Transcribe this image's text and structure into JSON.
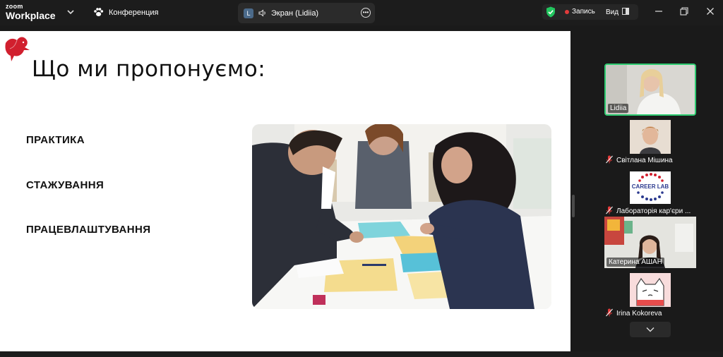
{
  "app": {
    "brand_small": "zoom",
    "brand_large": "Workplace"
  },
  "meeting": {
    "title": "Конференция"
  },
  "share": {
    "badge": "L",
    "label": "Экран (Lidiia)"
  },
  "toolbar": {
    "record_label": "Запись",
    "view_label": "Вид"
  },
  "slide": {
    "title": "Що ми пропонуємо:",
    "bullets": [
      "ПРАКТИКА",
      "СТАЖУВАННЯ",
      "ПРАЦЕВЛАШТУВАННЯ"
    ]
  },
  "participants": [
    {
      "name": "Lidiia",
      "muted": false,
      "active": true
    },
    {
      "name": "Світлана Мішина",
      "muted": true
    },
    {
      "name": "Лабораторія кар'єри ...",
      "muted": true,
      "logo_text": "CAREER LAB"
    },
    {
      "name": "Катерина АШАН",
      "muted": true
    },
    {
      "name": "Irina Kokoreva",
      "muted": true
    }
  ],
  "colors": {
    "accent_green": "#2ecc71",
    "record_red": "#e23b3b",
    "brand_red": "#d11f2e",
    "shield_green": "#22c55e"
  }
}
